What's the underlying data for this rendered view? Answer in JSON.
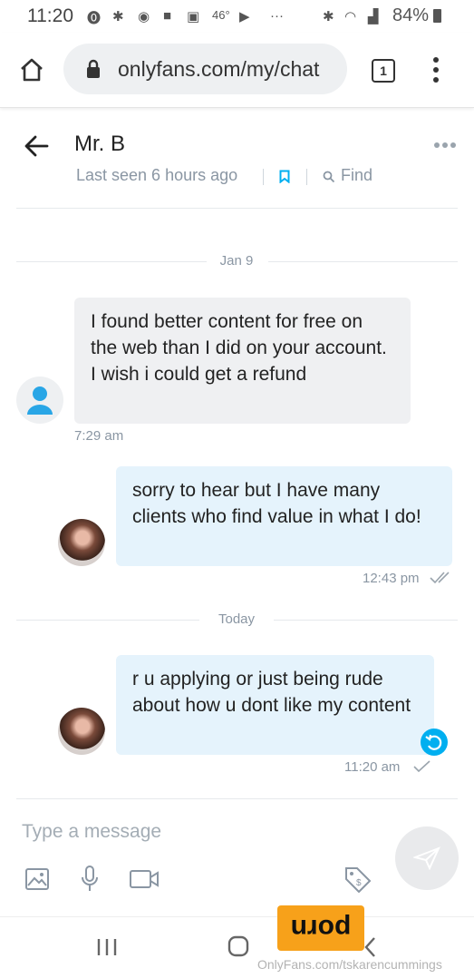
{
  "status_bar": {
    "time": "11:20",
    "temp": "46°",
    "dots": "···",
    "battery": "84%"
  },
  "browser": {
    "url": "onlyfans.com/my/chat",
    "tab_count": "1"
  },
  "chat": {
    "contact_name": "Mr. B",
    "last_seen": "Last seen 6 hours ago",
    "find_label": "Find",
    "accent_color": "#00aff0"
  },
  "messages": {
    "day1": "Jan 9",
    "m1_text": "I found better content for free on the web than I did on your account. I wish i could get a refund",
    "m1_time": "7:29 am",
    "m2_text": "sorry to hear but I have many clients who find value in what I do!",
    "m2_time": "12:43 pm",
    "day2": "Today",
    "m3_text": "r u applying or just being rude about how u dont like my content",
    "m3_time": "11:20 am"
  },
  "composer": {
    "placeholder": "Type a message"
  },
  "overlay": {
    "badge_text": "porn",
    "watermark": "OnlyFans.com/tskarencummings"
  }
}
